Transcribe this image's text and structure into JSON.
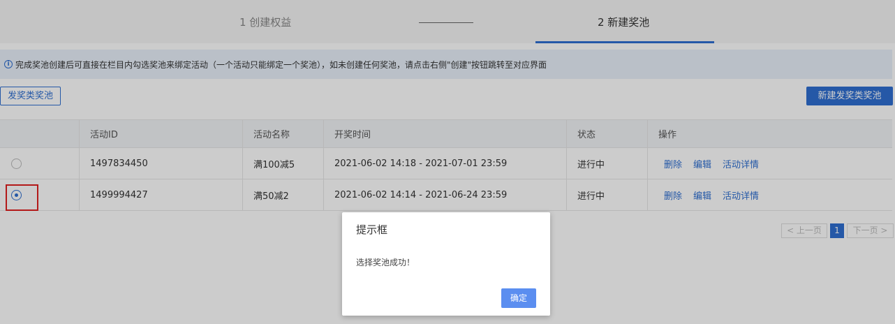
{
  "steps": {
    "step1_label": "1 创建权益",
    "step2_label": "2 新建奖池"
  },
  "notice": {
    "icon": "info-icon",
    "text": "完成奖池创建后可直接在栏目内勾选奖池来绑定活动（一个活动只能绑定一个奖池），如未创建任何奖池，请点击右侧\"创建\"按钮跳转至对应界面"
  },
  "toolbar": {
    "left_button": "发奖类奖池",
    "right_button": "新建发奖类奖池"
  },
  "table": {
    "headers": [
      "",
      "活动ID",
      "活动名称",
      "开奖时间",
      "状态",
      "操作"
    ],
    "rows": [
      {
        "selected": false,
        "id": "1497834450",
        "name": "满100减5",
        "time": "2021-06-02 14:18 - 2021-07-01 23:59",
        "status": "进行中",
        "actions": [
          "删除",
          "编辑",
          "活动详情"
        ]
      },
      {
        "selected": true,
        "id": "1499994427",
        "name": "满50减2",
        "time": "2021-06-02 14:14 - 2021-06-24 23:59",
        "status": "进行中",
        "actions": [
          "删除",
          "编辑",
          "活动详情"
        ]
      }
    ]
  },
  "pagination": {
    "prev": "< 上一页",
    "current": "1",
    "next": "下一页 >"
  },
  "dialog": {
    "title": "提示框",
    "message": "选择奖池成功！",
    "ok": "确定"
  },
  "colors": {
    "accent": "#2f6fd1",
    "highlight": "#e02020",
    "notice_bg": "#e9f1fb"
  }
}
